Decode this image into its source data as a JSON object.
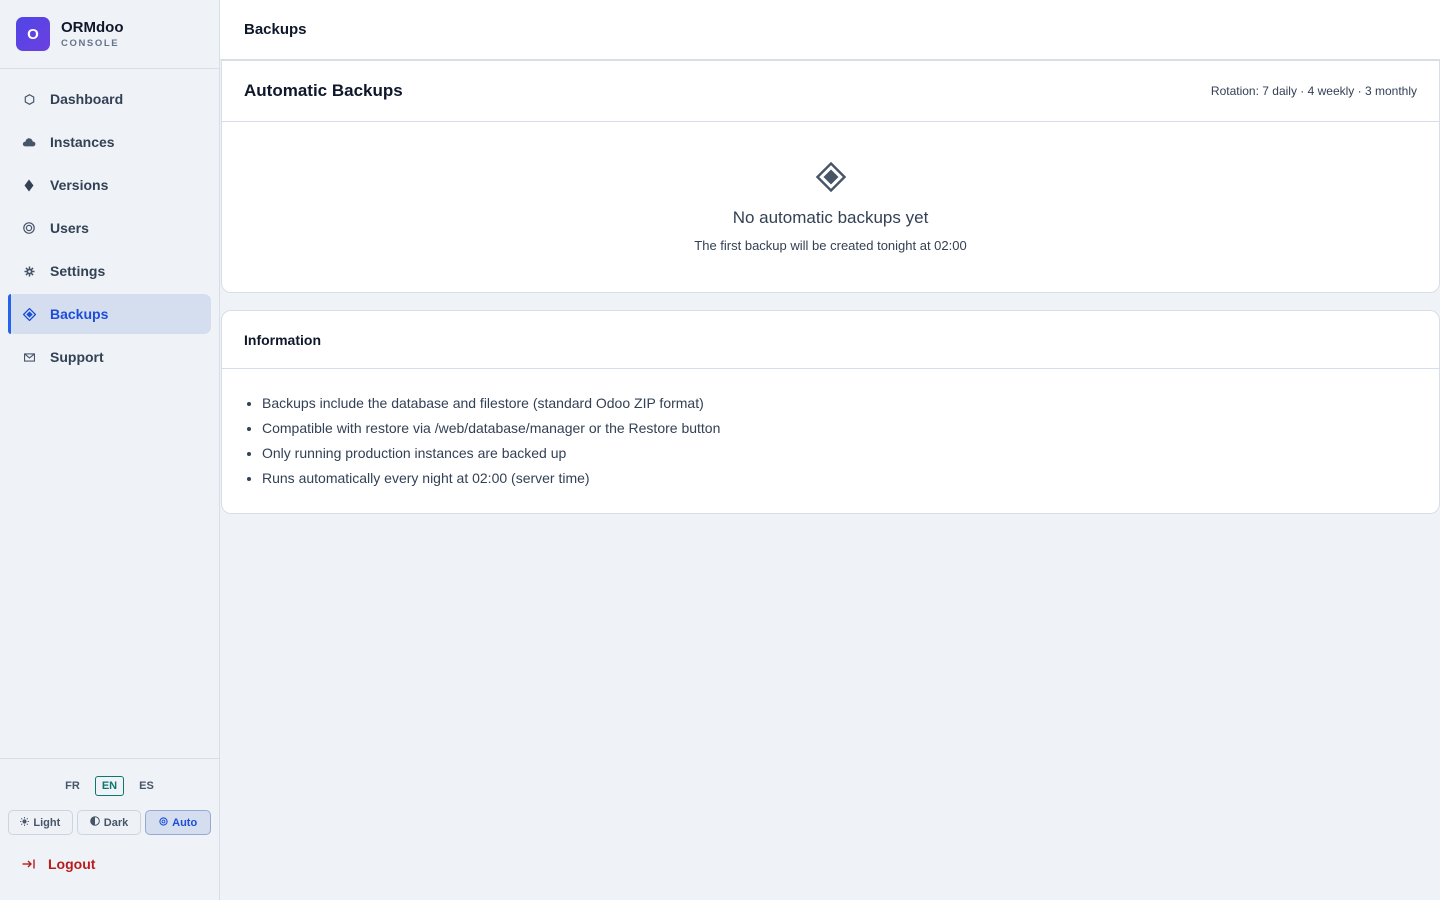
{
  "brand": {
    "logo_letter": "O",
    "name": "ORMdoo",
    "subtitle": "CONSOLE"
  },
  "nav": {
    "items": [
      {
        "label": "Dashboard",
        "icon": "hexagon-icon",
        "active": false
      },
      {
        "label": "Instances",
        "icon": "cloud-icon",
        "active": false
      },
      {
        "label": "Versions",
        "icon": "diamond-icon",
        "active": false
      },
      {
        "label": "Users",
        "icon": "users-icon",
        "active": false
      },
      {
        "label": "Settings",
        "icon": "gear-icon",
        "active": false
      },
      {
        "label": "Backups",
        "icon": "backup-diamond-icon",
        "active": true
      },
      {
        "label": "Support",
        "icon": "mail-icon",
        "active": false
      }
    ]
  },
  "footer": {
    "languages": [
      "FR",
      "EN",
      "ES"
    ],
    "active_language": "EN",
    "themes": {
      "light": "Light",
      "dark": "Dark",
      "auto": "Auto"
    },
    "active_theme": "Auto",
    "logout": "Logout"
  },
  "header": {
    "title": "Backups"
  },
  "automatic_backups": {
    "title": "Automatic Backups",
    "rotation": "Rotation: 7 daily · 4 weekly · 3 monthly",
    "empty_title": "No automatic backups yet",
    "empty_subtitle": "The first backup will be created tonight at 02:00"
  },
  "information": {
    "title": "Information",
    "items": [
      "Backups include the database and filestore (standard Odoo ZIP format)",
      "Compatible with restore via /web/database/manager or the Restore button",
      "Only running production instances are backed up",
      "Runs automatically every night at 02:00 (server time)"
    ]
  },
  "colors": {
    "accent": "#2563eb",
    "logout": "#b91c1c",
    "lang_active": "#0f766e"
  }
}
